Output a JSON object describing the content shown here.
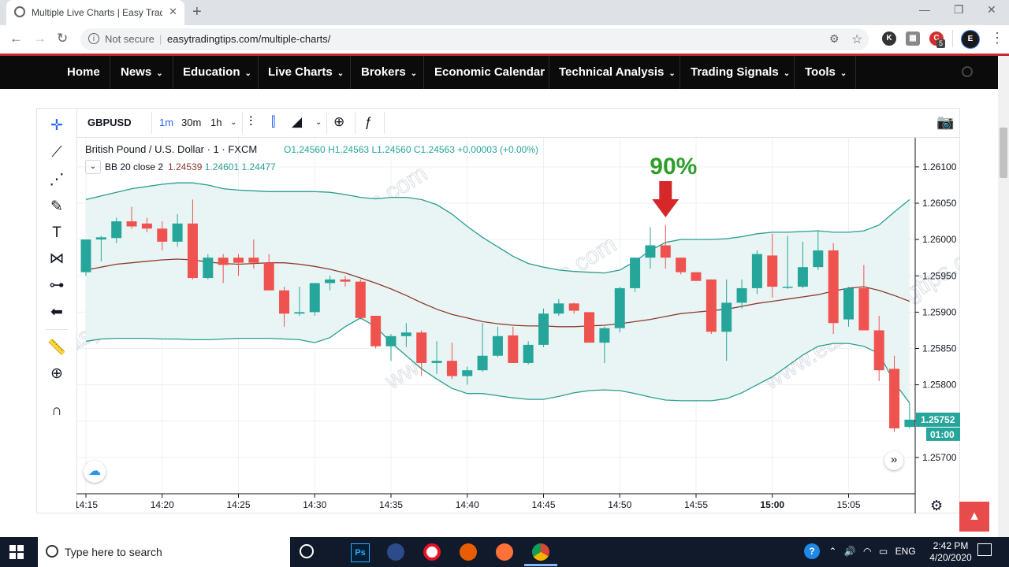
{
  "browser": {
    "tab_title": "Multiple Live Charts | Easy Tradin",
    "tab_close": "✕",
    "new_tab": "+",
    "security": "Not secure",
    "url": "easytradingtips.com/multiple-charts/",
    "profile_initial": "E",
    "ext_badge": "5"
  },
  "site_nav": {
    "items": [
      "Home",
      "News",
      "Education",
      "Live Charts",
      "Brokers",
      "Economic Calendar",
      "Technical Analysis",
      "Trading Signals",
      "Tools"
    ],
    "has_dropdown": [
      false,
      true,
      true,
      true,
      true,
      false,
      true,
      true,
      true
    ]
  },
  "chart_toolbar": {
    "symbol": "GBPUSD",
    "intervals": [
      "1m",
      "30m",
      "1h"
    ]
  },
  "legend": {
    "title": "British Pound / U.S. Dollar · 1 · FXCM",
    "o": "O1.24560",
    "h": "H1.24563",
    "l": "L1.24560",
    "c": "C1.24563",
    "change": "+0.00003 (+0.00%)",
    "bb_label": "BB 20 close 2",
    "bb_values": [
      "1.24539",
      "1.24601",
      "1.24477"
    ]
  },
  "annotation": {
    "text": "90%"
  },
  "price_badge": "1.25752",
  "countdown": "01:00",
  "watermark": "www.easytradingtips.com",
  "colors": {
    "up": "#26a69a",
    "down": "#ef5350",
    "band": "#e8f5f4",
    "basis": "#8d3b2f",
    "bands_line": "#2a9d8f",
    "nav_bg": "#0b0b0b",
    "accent_red": "#c1272d"
  },
  "chart_data": {
    "type": "candlestick",
    "title": "British Pound / U.S. Dollar · 1 · FXCM",
    "y_ticks": [
      "1.26100",
      "1.26050",
      "1.26000",
      "1.25950",
      "1.25900",
      "1.25850",
      "1.25800",
      "1.25750",
      "1.25700"
    ],
    "x_ticks": [
      "14:15",
      "14:20",
      "14:25",
      "14:30",
      "14:35",
      "14:40",
      "14:45",
      "14:50",
      "14:55",
      "15:00",
      "15:05"
    ],
    "ylim": [
      1.2565,
      1.2614
    ],
    "start_minute": 855,
    "candles": [
      {
        "o": 1.25955,
        "h": 1.25985,
        "l": 1.2595,
        "c": 1.26
      },
      {
        "o": 1.26,
        "h": 1.26005,
        "l": 1.2597,
        "c": 1.26003
      },
      {
        "o": 1.26002,
        "h": 1.2603,
        "l": 1.25995,
        "c": 1.26025
      },
      {
        "o": 1.26025,
        "h": 1.26045,
        "l": 1.26015,
        "c": 1.26018
      },
      {
        "o": 1.26022,
        "h": 1.2603,
        "l": 1.2601,
        "c": 1.26015
      },
      {
        "o": 1.26015,
        "h": 1.26025,
        "l": 1.25985,
        "c": 1.25997
      },
      {
        "o": 1.25997,
        "h": 1.26035,
        "l": 1.2599,
        "c": 1.26022
      },
      {
        "o": 1.26022,
        "h": 1.26055,
        "l": 1.25945,
        "c": 1.25947
      },
      {
        "o": 1.25947,
        "h": 1.2598,
        "l": 1.25945,
        "c": 1.25975
      },
      {
        "o": 1.25975,
        "h": 1.2598,
        "l": 1.2594,
        "c": 1.25965
      },
      {
        "o": 1.25975,
        "h": 1.2598,
        "l": 1.2595,
        "c": 1.25968
      },
      {
        "o": 1.25975,
        "h": 1.26,
        "l": 1.2596,
        "c": 1.25968
      },
      {
        "o": 1.25968,
        "h": 1.2598,
        "l": 1.2593,
        "c": 1.2593
      },
      {
        "o": 1.2593,
        "h": 1.25935,
        "l": 1.2588,
        "c": 1.25898
      },
      {
        "o": 1.25898,
        "h": 1.25935,
        "l": 1.25895,
        "c": 1.259
      },
      {
        "o": 1.259,
        "h": 1.2594,
        "l": 1.25895,
        "c": 1.2594
      },
      {
        "o": 1.2594,
        "h": 1.2595,
        "l": 1.2593,
        "c": 1.25945
      },
      {
        "o": 1.25945,
        "h": 1.2595,
        "l": 1.25935,
        "c": 1.25942
      },
      {
        "o": 1.25942,
        "h": 1.25945,
        "l": 1.2589,
        "c": 1.25892
      },
      {
        "o": 1.25895,
        "h": 1.25895,
        "l": 1.2585,
        "c": 1.25853
      },
      {
        "o": 1.25853,
        "h": 1.2587,
        "l": 1.25833,
        "c": 1.25867
      },
      {
        "o": 1.25867,
        "h": 1.25885,
        "l": 1.25852,
        "c": 1.25872
      },
      {
        "o": 1.25872,
        "h": 1.25875,
        "l": 1.25812,
        "c": 1.2583
      },
      {
        "o": 1.2583,
        "h": 1.2586,
        "l": 1.25815,
        "c": 1.25833
      },
      {
        "o": 1.25833,
        "h": 1.25858,
        "l": 1.25808,
        "c": 1.25812
      },
      {
        "o": 1.25812,
        "h": 1.25825,
        "l": 1.258,
        "c": 1.2582
      },
      {
        "o": 1.2582,
        "h": 1.25885,
        "l": 1.25818,
        "c": 1.2584
      },
      {
        "o": 1.2584,
        "h": 1.2588,
        "l": 1.25838,
        "c": 1.25867
      },
      {
        "o": 1.25868,
        "h": 1.2588,
        "l": 1.2583,
        "c": 1.2583
      },
      {
        "o": 1.2583,
        "h": 1.2586,
        "l": 1.25828,
        "c": 1.25855
      },
      {
        "o": 1.25855,
        "h": 1.25905,
        "l": 1.25852,
        "c": 1.25898
      },
      {
        "o": 1.25898,
        "h": 1.25918,
        "l": 1.25895,
        "c": 1.25912
      },
      {
        "o": 1.25912,
        "h": 1.25913,
        "l": 1.25898,
        "c": 1.25902
      },
      {
        "o": 1.259,
        "h": 1.259,
        "l": 1.25858,
        "c": 1.25858
      },
      {
        "o": 1.25858,
        "h": 1.2588,
        "l": 1.2583,
        "c": 1.25878
      },
      {
        "o": 1.25878,
        "h": 1.25935,
        "l": 1.25872,
        "c": 1.25933
      },
      {
        "o": 1.25933,
        "h": 1.25975,
        "l": 1.25928,
        "c": 1.25975
      },
      {
        "o": 1.25975,
        "h": 1.26017,
        "l": 1.2596,
        "c": 1.25992
      },
      {
        "o": 1.25992,
        "h": 1.2602,
        "l": 1.2596,
        "c": 1.25975
      },
      {
        "o": 1.25975,
        "h": 1.25975,
        "l": 1.25952,
        "c": 1.25955
      },
      {
        "o": 1.25955,
        "h": 1.25955,
        "l": 1.25943,
        "c": 1.25943
      },
      {
        "o": 1.25945,
        "h": 1.25945,
        "l": 1.2587,
        "c": 1.25873
      },
      {
        "o": 1.25873,
        "h": 1.25945,
        "l": 1.25833,
        "c": 1.25913
      },
      {
        "o": 1.25913,
        "h": 1.25945,
        "l": 1.25905,
        "c": 1.25933
      },
      {
        "o": 1.25933,
        "h": 1.25985,
        "l": 1.25925,
        "c": 1.2598
      },
      {
        "o": 1.25978,
        "h": 1.26008,
        "l": 1.2592,
        "c": 1.25935
      },
      {
        "o": 1.25935,
        "h": 1.26005,
        "l": 1.25932,
        "c": 1.25935
      },
      {
        "o": 1.25935,
        "h": 1.25997,
        "l": 1.25933,
        "c": 1.25962
      },
      {
        "o": 1.25962,
        "h": 1.26012,
        "l": 1.25958,
        "c": 1.25985
      },
      {
        "o": 1.25985,
        "h": 1.25995,
        "l": 1.2587,
        "c": 1.25885
      },
      {
        "o": 1.2589,
        "h": 1.25935,
        "l": 1.2588,
        "c": 1.25933
      },
      {
        "o": 1.25933,
        "h": 1.25965,
        "l": 1.2588,
        "c": 1.25875
      },
      {
        "o": 1.25875,
        "h": 1.25895,
        "l": 1.25805,
        "c": 1.2582
      },
      {
        "o": 1.25822,
        "h": 1.2584,
        "l": 1.25735,
        "c": 1.2574
      },
      {
        "o": 1.25742,
        "h": 1.25775,
        "l": 1.2574,
        "c": 1.25752
      }
    ],
    "bb_upper": [
      1.26055,
      1.2606,
      1.26065,
      1.2607,
      1.26073,
      1.26076,
      1.26078,
      1.26078,
      1.26075,
      1.2607,
      1.26068,
      1.26067,
      1.26066,
      1.26066,
      1.26066,
      1.26066,
      1.26065,
      1.26062,
      1.26058,
      1.26056,
      1.26058,
      1.26058,
      1.26055,
      1.26048,
      1.26035,
      1.26018,
      1.26003,
      1.2599,
      1.25977,
      1.25967,
      1.25962,
      1.25958,
      1.25956,
      1.25955,
      1.25954,
      1.25958,
      1.2597,
      1.25985,
      1.25996,
      1.26,
      1.26,
      1.26,
      1.26001,
      1.26004,
      1.26008,
      1.2601,
      1.2601,
      1.26011,
      1.26012,
      1.2601,
      1.2601,
      1.26012,
      1.2602,
      1.26038,
      1.26055
    ],
    "bb_basis": [
      1.25958,
      1.25962,
      1.25966,
      1.25968,
      1.2597,
      1.25972,
      1.25973,
      1.25972,
      1.25969,
      1.25967,
      1.25966,
      1.25967,
      1.25968,
      1.25968,
      1.25966,
      1.25963,
      1.25959,
      1.25954,
      1.25947,
      1.2594,
      1.25932,
      1.25923,
      1.25913,
      1.25904,
      1.25897,
      1.25892,
      1.25887,
      1.25884,
      1.25882,
      1.25881,
      1.25881,
      1.2588,
      1.2588,
      1.25881,
      1.25882,
      1.25884,
      1.25887,
      1.2589,
      1.25894,
      1.25898,
      1.259,
      1.25902,
      1.25904,
      1.25908,
      1.25912,
      1.25915,
      1.25918,
      1.25921,
      1.25924,
      1.25929,
      1.25933,
      1.25935,
      1.2593,
      1.25923,
      1.25915
    ],
    "bb_lower": [
      1.2586,
      1.25863,
      1.25864,
      1.25864,
      1.25864,
      1.25863,
      1.25863,
      1.25862,
      1.25862,
      1.25863,
      1.25864,
      1.25864,
      1.25864,
      1.25863,
      1.25862,
      1.25858,
      1.25865,
      1.2588,
      1.25892,
      1.2588,
      1.25858,
      1.2584,
      1.25822,
      1.25808,
      1.25795,
      1.25788,
      1.25788,
      1.25785,
      1.25782,
      1.2578,
      1.2578,
      1.25784,
      1.25789,
      1.25792,
      1.25793,
      1.25792,
      1.25788,
      1.25783,
      1.25779,
      1.25778,
      1.25778,
      1.25778,
      1.25781,
      1.25789,
      1.258,
      1.25811,
      1.25826,
      1.25841,
      1.25853,
      1.25857,
      1.25857,
      1.25853,
      1.25843,
      1.25803,
      1.25775
    ]
  },
  "taskbar": {
    "search_placeholder": "Type here to search",
    "time": "2:42 PM",
    "date": "4/20/2020",
    "lang": "ENG"
  }
}
